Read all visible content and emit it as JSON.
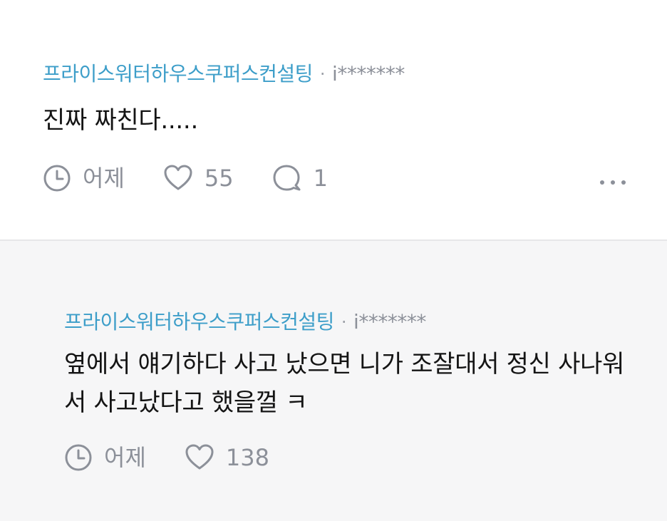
{
  "posts": [
    {
      "company": "프라이스워터하우스쿠퍼스컨설팅",
      "separator": "·",
      "author": "i*******",
      "text": "진짜 짜친다.....",
      "time": "어제",
      "likes": "55",
      "comments": "1",
      "icons": [
        "clock-icon",
        "heart-icon",
        "comment-icon",
        "more-icon"
      ]
    },
    {
      "company": "프라이스워터하우스쿠퍼스컨설팅",
      "separator": "·",
      "author": "i*******",
      "text": "옆에서 얘기하다 사고 났으면 니가 조잘대서 정신 사나워서 사고났다고 했을껄 ㅋ",
      "time": "어제",
      "likes": "138",
      "icons": [
        "clock-icon",
        "heart-icon"
      ]
    }
  ],
  "colors": {
    "company": "#3d9ec9",
    "muted": "#8c9099",
    "reply_background": "#f6f6f7",
    "divider": "#e7e7e9"
  }
}
